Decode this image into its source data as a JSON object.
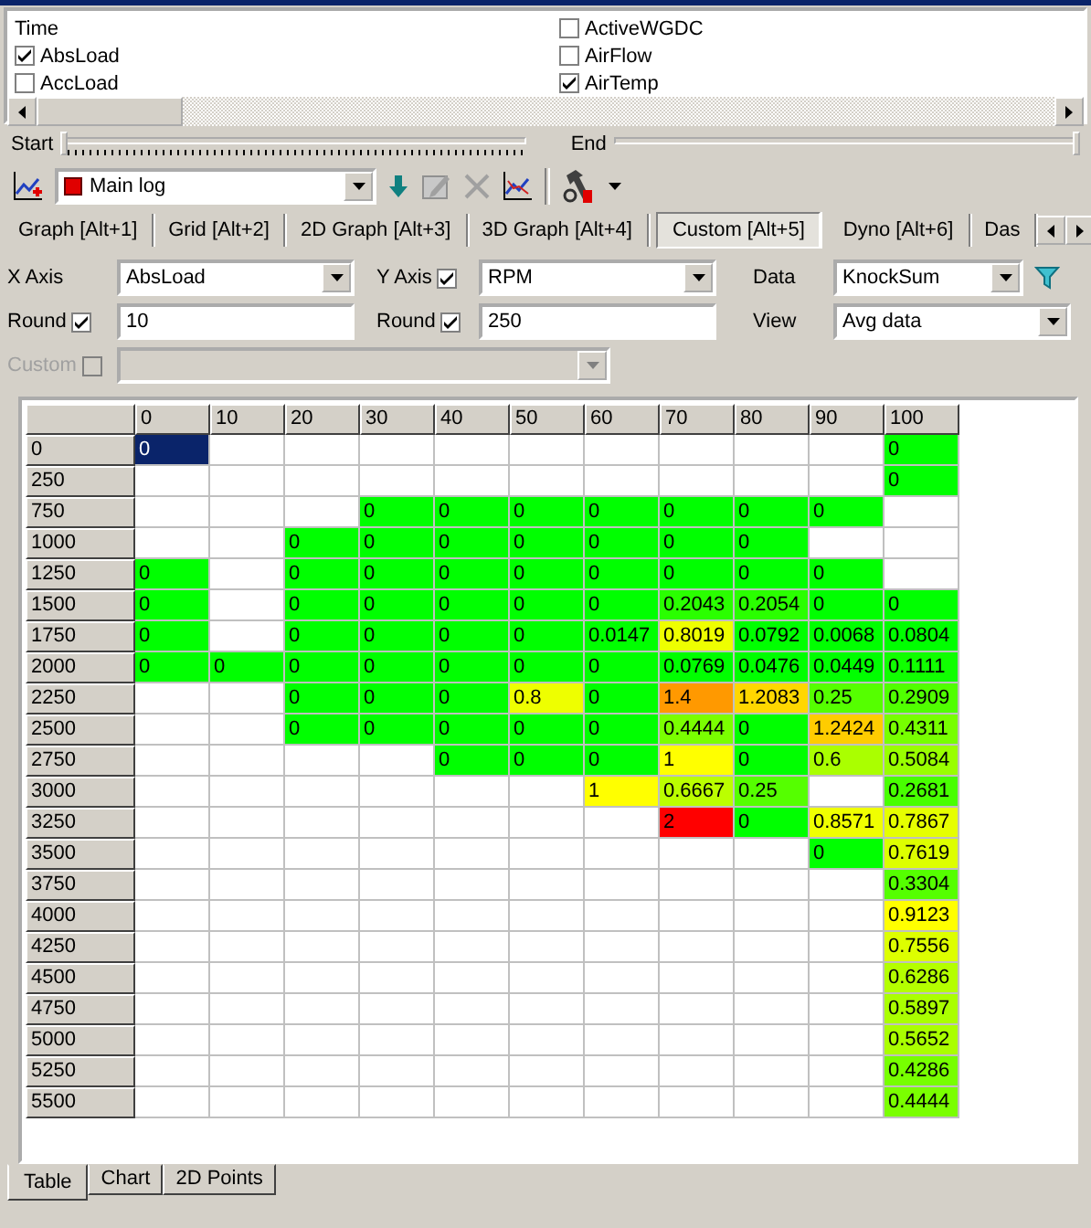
{
  "channel_list": {
    "items": [
      {
        "label": "Time",
        "kind": "plain"
      },
      {
        "label": "AbsLoad",
        "kind": "checkbox",
        "checked": true
      },
      {
        "label": "AccLoad",
        "kind": "checkbox",
        "checked": false
      },
      {
        "label": "ActiveWGDC",
        "kind": "checkbox",
        "checked": false
      },
      {
        "label": "AirFlow",
        "kind": "checkbox",
        "checked": false
      },
      {
        "label": "AirTemp",
        "kind": "checkbox",
        "checked": true
      }
    ]
  },
  "range": {
    "start": {
      "label": "Start",
      "level": 0
    },
    "end": {
      "label": "End",
      "level": 1
    }
  },
  "toolbar": {
    "log_select": {
      "value": "Main log"
    }
  },
  "view_tabs": [
    {
      "label": "Graph [Alt+1]",
      "selected": false
    },
    {
      "label": "Grid [Alt+2]",
      "selected": false
    },
    {
      "label": "2D Graph [Alt+3]",
      "selected": false
    },
    {
      "label": "3D Graph [Alt+4]",
      "selected": false
    },
    {
      "label": "Custom [Alt+5]",
      "selected": true
    },
    {
      "label": "Dyno [Alt+6]",
      "selected": false
    },
    {
      "label": "Das",
      "selected": false
    }
  ],
  "axes": {
    "x_axis": {
      "label": "X Axis",
      "value": "AbsLoad"
    },
    "y_axis": {
      "label": "Y Axis",
      "checked": true,
      "value": "RPM"
    },
    "data": {
      "label": "Data",
      "value": "KnockSum"
    },
    "x_round": {
      "label": "Round",
      "checked": true,
      "value": "10"
    },
    "y_round": {
      "label": "Round",
      "checked": true,
      "value": "250"
    },
    "view": {
      "label": "View",
      "value": "Avg data"
    },
    "custom": {
      "label": "Custom",
      "checked": false,
      "disabled": true
    }
  },
  "table": {
    "columns": [
      "0",
      "10",
      "20",
      "30",
      "40",
      "50",
      "60",
      "70",
      "80",
      "90",
      "100"
    ],
    "rows": [
      {
        "label": "0",
        "cells": [
          {
            "value": "0",
            "selected": true
          },
          null,
          null,
          null,
          null,
          null,
          null,
          null,
          null,
          null,
          {
            "value": "0",
            "color": "#00ff00",
            "selected": false
          }
        ]
      },
      {
        "label": "250",
        "cells": [
          null,
          null,
          null,
          null,
          null,
          null,
          null,
          null,
          null,
          null,
          {
            "value": "0",
            "color": "#00ff00",
            "selected": false
          }
        ]
      },
      {
        "label": "750",
        "cells": [
          null,
          null,
          null,
          {
            "value": "0",
            "color": "#00ff00",
            "selected": false
          },
          {
            "value": "0",
            "color": "#00ff00",
            "selected": false
          },
          {
            "value": "0",
            "color": "#00ff00",
            "selected": false
          },
          {
            "value": "0",
            "color": "#00ff00",
            "selected": false
          },
          {
            "value": "0",
            "color": "#00ff00",
            "selected": false
          },
          {
            "value": "0",
            "color": "#00ff00",
            "selected": false
          },
          {
            "value": "0",
            "color": "#00ff00",
            "selected": false
          },
          null
        ]
      },
      {
        "label": "1000",
        "cells": [
          null,
          null,
          {
            "value": "0",
            "color": "#00ff00",
            "selected": false
          },
          {
            "value": "0",
            "color": "#00ff00",
            "selected": false
          },
          {
            "value": "0",
            "color": "#00ff00",
            "selected": false
          },
          {
            "value": "0",
            "color": "#00ff00",
            "selected": false
          },
          {
            "value": "0",
            "color": "#00ff00",
            "selected": false
          },
          {
            "value": "0",
            "color": "#00ff00",
            "selected": false
          },
          {
            "value": "0",
            "color": "#00ff00",
            "selected": false
          },
          null,
          null
        ]
      },
      {
        "label": "1250",
        "cells": [
          {
            "value": "0",
            "color": "#00ff00",
            "selected": false
          },
          null,
          {
            "value": "0",
            "color": "#00ff00",
            "selected": false
          },
          {
            "value": "0",
            "color": "#00ff00",
            "selected": false
          },
          {
            "value": "0",
            "color": "#00ff00",
            "selected": false
          },
          {
            "value": "0",
            "color": "#00ff00",
            "selected": false
          },
          {
            "value": "0",
            "color": "#00ff00",
            "selected": false
          },
          {
            "value": "0",
            "color": "#00ff00",
            "selected": false
          },
          {
            "value": "0",
            "color": "#00ff00",
            "selected": false
          },
          {
            "value": "0",
            "color": "#00ff00",
            "selected": false
          },
          null
        ]
      },
      {
        "label": "1500",
        "cells": [
          {
            "value": "0",
            "color": "#00ff00",
            "selected": false
          },
          null,
          {
            "value": "0",
            "color": "#00ff00",
            "selected": false
          },
          {
            "value": "0",
            "color": "#00ff00",
            "selected": false
          },
          {
            "value": "0",
            "color": "#00ff00",
            "selected": false
          },
          {
            "value": "0",
            "color": "#00ff00",
            "selected": false
          },
          {
            "value": "0",
            "color": "#00ff00",
            "selected": false
          },
          {
            "value": "0.2043",
            "color": "#2aff00",
            "selected": false
          },
          {
            "value": "0.2054",
            "color": "#2aff00",
            "selected": false
          },
          {
            "value": "0",
            "color": "#00ff00",
            "selected": false
          },
          {
            "value": "0",
            "color": "#00ff00",
            "selected": false
          }
        ]
      },
      {
        "label": "1750",
        "cells": [
          {
            "value": "0",
            "color": "#00ff00",
            "selected": false
          },
          null,
          {
            "value": "0",
            "color": "#00ff00",
            "selected": false
          },
          {
            "value": "0",
            "color": "#00ff00",
            "selected": false
          },
          {
            "value": "0",
            "color": "#00ff00",
            "selected": false
          },
          {
            "value": "0",
            "color": "#00ff00",
            "selected": false
          },
          {
            "value": "0.0147",
            "color": "#00ff00",
            "selected": false
          },
          {
            "value": "0.8019",
            "color": "#eeff00",
            "selected": false
          },
          {
            "value": "0.0792",
            "color": "#00ff00",
            "selected": false
          },
          {
            "value": "0.0068",
            "color": "#00ff00",
            "selected": false
          },
          {
            "value": "0.0804",
            "color": "#00ff00",
            "selected": false
          }
        ]
      },
      {
        "label": "2000",
        "cells": [
          {
            "value": "0",
            "color": "#00ff00",
            "selected": false
          },
          {
            "value": "0",
            "color": "#00ff00",
            "selected": false
          },
          {
            "value": "0",
            "color": "#00ff00",
            "selected": false
          },
          {
            "value": "0",
            "color": "#00ff00",
            "selected": false
          },
          {
            "value": "0",
            "color": "#00ff00",
            "selected": false
          },
          {
            "value": "0",
            "color": "#00ff00",
            "selected": false
          },
          {
            "value": "0",
            "color": "#00ff00",
            "selected": false
          },
          {
            "value": "0.0769",
            "color": "#00ff00",
            "selected": false
          },
          {
            "value": "0.0476",
            "color": "#00ff00",
            "selected": false
          },
          {
            "value": "0.0449",
            "color": "#00ff00",
            "selected": false
          },
          {
            "value": "0.1111",
            "color": "#10ff00",
            "selected": false
          }
        ]
      },
      {
        "label": "2250",
        "cells": [
          null,
          null,
          {
            "value": "0",
            "color": "#00ff00",
            "selected": false
          },
          {
            "value": "0",
            "color": "#00ff00",
            "selected": false
          },
          {
            "value": "0",
            "color": "#00ff00",
            "selected": false
          },
          {
            "value": "0.8",
            "color": "#eeff00",
            "selected": false
          },
          {
            "value": "0",
            "color": "#00ff00",
            "selected": false
          },
          {
            "value": "1.4",
            "color": "#ff9900",
            "selected": false
          },
          {
            "value": "1.2083",
            "color": "#ffd700",
            "selected": false
          },
          {
            "value": "0.25",
            "color": "#55ff00",
            "selected": false
          },
          {
            "value": "0.2909",
            "color": "#50ff00",
            "selected": false
          }
        ]
      },
      {
        "label": "2500",
        "cells": [
          null,
          null,
          {
            "value": "0",
            "color": "#00ff00",
            "selected": false
          },
          {
            "value": "0",
            "color": "#00ff00",
            "selected": false
          },
          {
            "value": "0",
            "color": "#00ff00",
            "selected": false
          },
          {
            "value": "0",
            "color": "#00ff00",
            "selected": false
          },
          {
            "value": "0",
            "color": "#00ff00",
            "selected": false
          },
          {
            "value": "0.4444",
            "color": "#7aff00",
            "selected": false
          },
          {
            "value": "0",
            "color": "#00ff00",
            "selected": false
          },
          {
            "value": "1.2424",
            "color": "#ffcc00",
            "selected": false
          },
          {
            "value": "0.4311",
            "color": "#77ff00",
            "selected": false
          }
        ]
      },
      {
        "label": "2750",
        "cells": [
          null,
          null,
          null,
          null,
          {
            "value": "0",
            "color": "#00ff00",
            "selected": false
          },
          {
            "value": "0",
            "color": "#00ff00",
            "selected": false
          },
          {
            "value": "0",
            "color": "#00ff00",
            "selected": false
          },
          {
            "value": "1",
            "color": "#ffff00",
            "selected": false
          },
          {
            "value": "0",
            "color": "#00ff00",
            "selected": false
          },
          {
            "value": "0.6",
            "color": "#aaff00",
            "selected": false
          },
          {
            "value": "0.5084",
            "color": "#99ff00",
            "selected": false
          }
        ]
      },
      {
        "label": "3000",
        "cells": [
          null,
          null,
          null,
          null,
          null,
          null,
          {
            "value": "1",
            "color": "#ffff00",
            "selected": false
          },
          {
            "value": "0.6667",
            "color": "#bbff00",
            "selected": false
          },
          {
            "value": "0.25",
            "color": "#55ff00",
            "selected": false
          },
          null,
          {
            "value": "0.2681",
            "color": "#48ff00",
            "selected": false
          }
        ]
      },
      {
        "label": "3250",
        "cells": [
          null,
          null,
          null,
          null,
          null,
          null,
          null,
          {
            "value": "2",
            "color": "#ff0000",
            "selected": false
          },
          {
            "value": "0",
            "color": "#00ff00",
            "selected": false
          },
          {
            "value": "0.8571",
            "color": "#f0ff00",
            "selected": false
          },
          {
            "value": "0.7867",
            "color": "#e6ff00",
            "selected": false
          }
        ]
      },
      {
        "label": "3500",
        "cells": [
          null,
          null,
          null,
          null,
          null,
          null,
          null,
          null,
          null,
          {
            "value": "0",
            "color": "#00ff00",
            "selected": false
          },
          {
            "value": "0.7619",
            "color": "#ddff00",
            "selected": false
          }
        ]
      },
      {
        "label": "3750",
        "cells": [
          null,
          null,
          null,
          null,
          null,
          null,
          null,
          null,
          null,
          null,
          {
            "value": "0.3304",
            "color": "#55ff00",
            "selected": false
          }
        ]
      },
      {
        "label": "4000",
        "cells": [
          null,
          null,
          null,
          null,
          null,
          null,
          null,
          null,
          null,
          null,
          {
            "value": "0.9123",
            "color": "#ffff00",
            "selected": false
          }
        ]
      },
      {
        "label": "4250",
        "cells": [
          null,
          null,
          null,
          null,
          null,
          null,
          null,
          null,
          null,
          null,
          {
            "value": "0.7556",
            "color": "#ddff00",
            "selected": false
          }
        ]
      },
      {
        "label": "4500",
        "cells": [
          null,
          null,
          null,
          null,
          null,
          null,
          null,
          null,
          null,
          null,
          {
            "value": "0.6286",
            "color": "#b4ff00",
            "selected": false
          }
        ]
      },
      {
        "label": "4750",
        "cells": [
          null,
          null,
          null,
          null,
          null,
          null,
          null,
          null,
          null,
          null,
          {
            "value": "0.5897",
            "color": "#aaff00",
            "selected": false
          }
        ]
      },
      {
        "label": "5000",
        "cells": [
          null,
          null,
          null,
          null,
          null,
          null,
          null,
          null,
          null,
          null,
          {
            "value": "0.5652",
            "color": "#aaff00",
            "selected": false
          }
        ]
      },
      {
        "label": "5250",
        "cells": [
          null,
          null,
          null,
          null,
          null,
          null,
          null,
          null,
          null,
          null,
          {
            "value": "0.4286",
            "color": "#77ff00",
            "selected": false
          }
        ]
      },
      {
        "label": "5500",
        "cells": [
          null,
          null,
          null,
          null,
          null,
          null,
          null,
          null,
          null,
          null,
          {
            "value": "0.4444",
            "color": "#7aff00",
            "selected": false
          }
        ]
      }
    ]
  },
  "bottom_tabs": [
    {
      "label": "Table",
      "selected": true
    },
    {
      "label": "Chart",
      "selected": false
    },
    {
      "label": "2D Points",
      "selected": false
    }
  ]
}
